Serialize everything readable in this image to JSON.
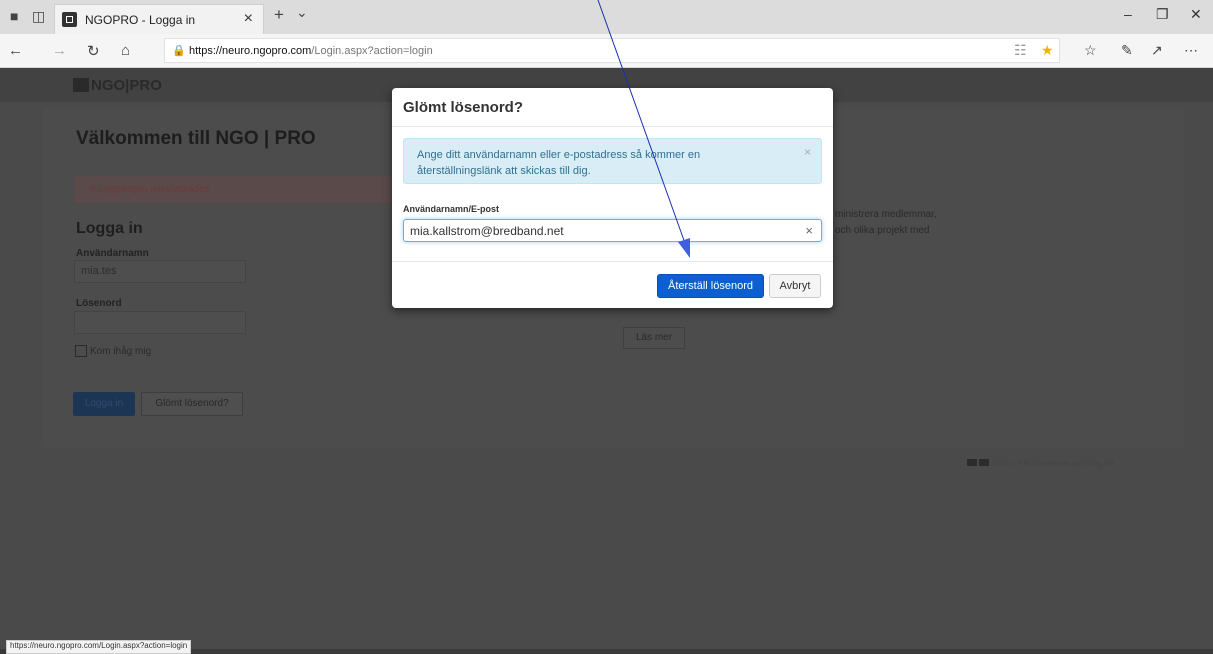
{
  "browser": {
    "tab_title": "NGOPRO - Logga in",
    "tab_close": "×",
    "new_tab": "+",
    "tab_menu": "⌄",
    "url_host": "https://neuro.ngopro.com",
    "url_path": "/Login.aspx?action=login",
    "status_url": "https://neuro.ngopro.com/Login.aspx?action=login"
  },
  "page": {
    "logo": "NGO|PRO",
    "welcome": "Välkommen till NGO | PRO",
    "alert": "Inloggningen misslyckades",
    "login_heading": "Logga in",
    "username_label": "Användarnamn",
    "username_value": "mia.tes",
    "password_label": "Lösenord",
    "remember_label": "Kom ihåg mig",
    "login_button": "Logga in",
    "forgot_button": "Glömt lösenord?",
    "info_line1": "ministrera medlemmar,",
    "info_line2": "och olika projekt med",
    "read_more": "Läs mer",
    "footer": "NGO | PRO levereras av Idrog AB"
  },
  "modal": {
    "title": "Glömt lösenord?",
    "info_text": "Ange ditt användarnamn eller e-postadress så kommer en återställningslänk att skickas till dig.",
    "field_label": "Användarnamn/E-post",
    "field_value": "mia.kallstrom@bredband.net",
    "reset_button": "Återställ lösenord",
    "cancel_button": "Avbryt"
  },
  "colors": {
    "primary": "#0c5fd0",
    "info_bg": "#d9edf7",
    "annotation": "#1a2fb0"
  }
}
